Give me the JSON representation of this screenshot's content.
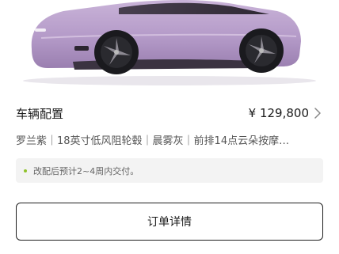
{
  "car": {
    "image": "car-side-view",
    "color_hex": "#b59bc9"
  },
  "config": {
    "title": "车辆配置",
    "price": "¥ 129,800",
    "chevron_icon": "chevron-right-icon",
    "summary": "罗兰紫｜18英寸低风阻轮毂｜晨雾灰｜前排14点云朵按摩…"
  },
  "notice": {
    "dot_color": "#8fc22b",
    "text": "改配后预计2~4周内交付。"
  },
  "order_button": {
    "label": "订单详情"
  }
}
